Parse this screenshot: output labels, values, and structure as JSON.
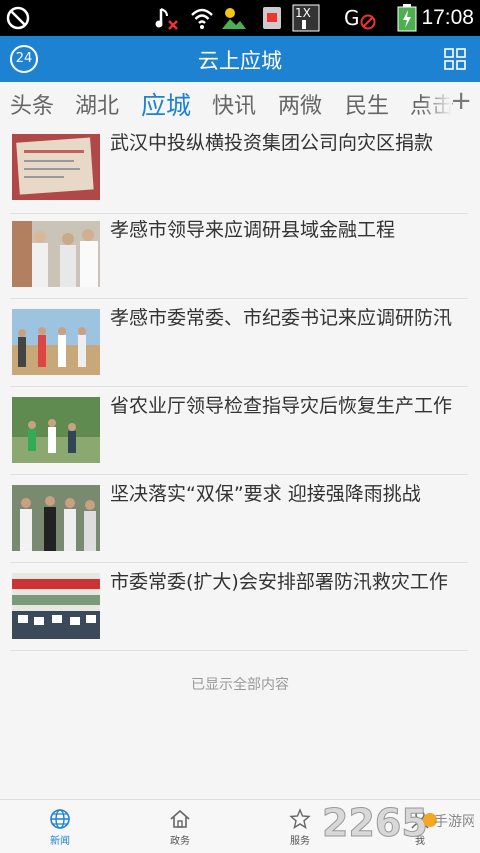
{
  "statusbar": {
    "time": "17:08",
    "network_label": "1X"
  },
  "header": {
    "title": "云上应城",
    "weather_badge": "24"
  },
  "tabs": [
    {
      "label": "头条"
    },
    {
      "label": "湖北"
    },
    {
      "label": "应城",
      "active": true
    },
    {
      "label": "快讯"
    },
    {
      "label": "两微"
    },
    {
      "label": "民生"
    },
    {
      "label": "点击"
    }
  ],
  "news": [
    {
      "title": "武汉中投纵横投资集团公司向灾区捐款"
    },
    {
      "title": "孝感市领导来应调研县域金融工程"
    },
    {
      "title": "孝感市委常委、市纪委书记来应调研防汛"
    },
    {
      "title": "省农业厅领导检查指导灾后恢复生产工作"
    },
    {
      "title": "坚决落实“双保”要求 迎接强降雨挑战"
    },
    {
      "title": "市委常委(扩大)会安排部署防汛救灾工作"
    }
  ],
  "footer_note": "已显示全部内容",
  "bottom_nav": [
    {
      "label": "新闻",
      "icon": "globe-icon",
      "active": true
    },
    {
      "label": "政务",
      "icon": "home-icon"
    },
    {
      "label": "服务",
      "icon": "star-icon"
    },
    {
      "label": "我",
      "icon": "person-icon"
    }
  ],
  "watermark": {
    "logo": "2265",
    "sub": "手游网"
  },
  "colors": {
    "accent": "#1e82d2",
    "statusbar": "#000000"
  }
}
